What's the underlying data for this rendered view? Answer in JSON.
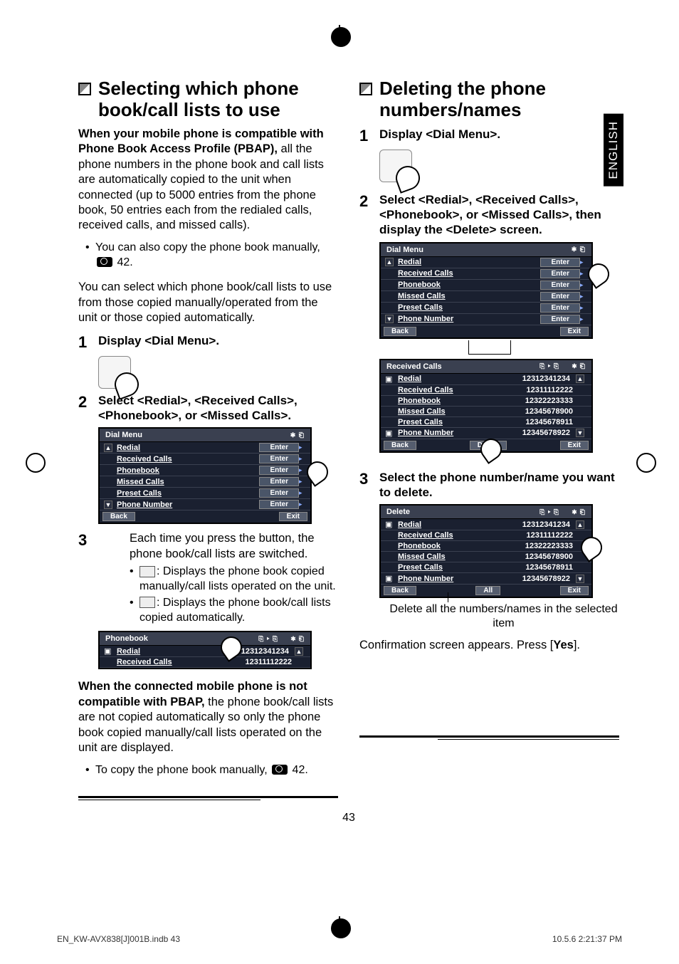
{
  "side_tab": "ENGLISH",
  "page_number": "43",
  "print": {
    "file": "EN_KW-AVX838[J]001B.indb   43",
    "timestamp": "10.5.6   2:21:37 PM"
  },
  "left": {
    "heading": "Selecting which phone book/call lists to use",
    "intro_bold": "When your mobile phone is compatible with Phone Book Access Profile (PBAP),",
    "intro_rest": " all the phone numbers in the phone book and call lists are automatically copied to the unit when connected (up to 5000 entries from the phone book, 50 entries each from the redialed calls, received calls, and missed calls).",
    "bullet_copy_manual": "You can also copy the phone book manually,",
    "bullet_copy_manual_ref": "42.",
    "para_select": "You can select which phone book/call lists to use from those copied manually/operated from the unit or those copied automatically.",
    "step1": "Display <Dial Menu>.",
    "step2": "Select <Redial>, <Received Calls>, <Phonebook>, or <Missed Calls>.",
    "screen_dial": {
      "title": "Dial Menu",
      "items": [
        "Redial",
        "Received Calls",
        "Phonebook",
        "Missed Calls",
        "Preset Calls",
        "Phone Number"
      ],
      "enter": "Enter",
      "back": "Back",
      "exit": "Exit"
    },
    "step3_text": "Each time you press the button, the phone book/call lists are switched.",
    "step3_bullet1": ": Displays the phone book copied manually/call lists operated on the unit.",
    "step3_bullet2": ": Displays the phone book/call lists copied automatically.",
    "screen_pb": {
      "title": "Phonebook",
      "items": [
        "Redial",
        "Received Calls"
      ],
      "values": [
        "12312341234",
        "12311112222"
      ]
    },
    "note_bold": "When the connected mobile phone is not compatible with PBAP,",
    "note_rest": " the phone book/call lists are not copied automatically so only the phone book copied manually/call lists operated on the unit are displayed.",
    "note_bullet": "To copy the phone book manually,",
    "note_bullet_ref": "42."
  },
  "right": {
    "heading": "Deleting the phone numbers/names",
    "step1": "Display <Dial Menu>.",
    "step2": "Select <Redial>, <Received Calls>, <Phonebook>, or <Missed Calls>, then display the <Delete> screen.",
    "screen_dial": {
      "title": "Dial Menu",
      "items": [
        "Redial",
        "Received Calls",
        "Phonebook",
        "Missed Calls",
        "Preset Calls",
        "Phone Number"
      ],
      "enter": "Enter",
      "back": "Back",
      "exit": "Exit"
    },
    "screen_received": {
      "title": "Received Calls",
      "items": [
        "Redial",
        "Received Calls",
        "Phonebook",
        "Missed Calls",
        "Preset Calls",
        "Phone Number"
      ],
      "values": [
        "12312341234",
        "12311112222",
        "12322223333",
        "12345678900",
        "12345678911",
        "12345678922"
      ],
      "back": "Back",
      "delete": "Delete",
      "exit": "Exit"
    },
    "step3": "Select the phone number/name you want to delete.",
    "screen_delete": {
      "title": "Delete",
      "items": [
        "Redial",
        "Received Calls",
        "Phonebook",
        "Missed Calls",
        "Preset Calls",
        "Phone Number"
      ],
      "values": [
        "12312341234",
        "12311112222",
        "12322223333",
        "12345678900",
        "12345678911",
        "12345678922"
      ],
      "back": "Back",
      "all": "All",
      "exit": "Exit"
    },
    "note_all": "Delete all the numbers/names in the selected item",
    "confirm_pre": "Confirmation screen appears. Press [",
    "confirm_yes": "Yes",
    "confirm_post": "]."
  }
}
